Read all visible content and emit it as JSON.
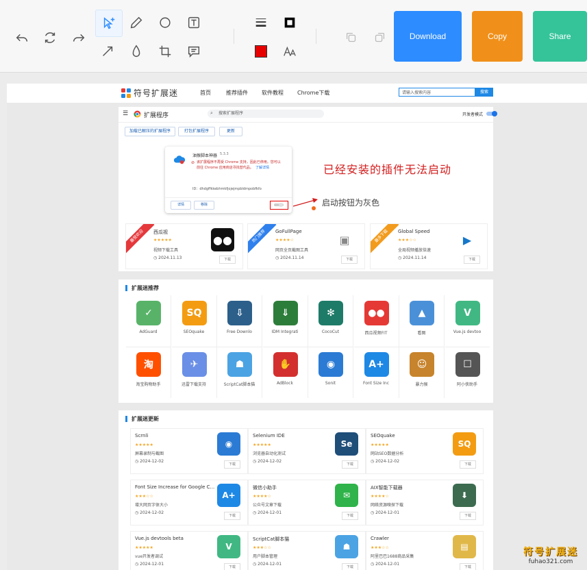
{
  "toolbar": {
    "buttons": {
      "download": "Download",
      "copy": "Copy",
      "share": "Share"
    },
    "colors": {
      "download": "#2d8cff",
      "copy": "#f0901a",
      "share": "#35c49a",
      "swatch": "#e60000"
    }
  },
  "site": {
    "logo_text": "符号扩展迷",
    "nav": [
      "首页",
      "推荐插件",
      "软件教程",
      "Chrome下载"
    ],
    "search_placeholder": "请输入搜索内容",
    "search_button": "搜索"
  },
  "ext_page": {
    "title": "扩展程序",
    "search": "搜索扩展程序",
    "dev_mode": "开发者模式",
    "buttons": [
      "加载已解压的扩展程序",
      "打包扩展程序",
      "更新"
    ],
    "card": {
      "name": "油猴脚本神器",
      "version": "5.3.3",
      "warning": "该扩展程序不再受 Chrome 支持，因此已停用。您可以",
      "warning2": "前往 Chrome 应用商店寻找替代品。",
      "link": "了解详情",
      "id_line": "ID：dhdgffkkebhmkfjojejmpbldmpobfkfo",
      "details": "详情",
      "remove": "移除"
    },
    "annotation_main": "已经安装的插件无法启动",
    "annotation_toggle": "启动按钮为灰色"
  },
  "featured": [
    {
      "ribbon": "最受欢迎",
      "ribbon_color": "#e5383b",
      "name": "西瓜视",
      "stars": "★★★★★",
      "desc": "视频下载工具",
      "date": "2024.11.13",
      "dl": "下载"
    },
    {
      "ribbon": "热门推荐",
      "ribbon_color": "#2f80ed",
      "name": "GoFullPage",
      "stars": "★★★★☆",
      "desc": "网页全页截图工具",
      "date": "2024.11.14",
      "dl": "下载"
    },
    {
      "ribbon": "最多下载",
      "ribbon_color": "#f29b1d",
      "name": "Global Speed",
      "stars": "★★★☆☆",
      "desc": "全局视频播放倍速",
      "date": "2024.11.14",
      "dl": "下载"
    }
  ],
  "recommend": {
    "title": "扩展迷推荐",
    "items": [
      {
        "label": "AdGuard",
        "color": "#58b368",
        "glyph": "✓"
      },
      {
        "label": "SEOquake",
        "color": "#f39c12",
        "glyph": "SQ"
      },
      {
        "label": "Free Downlo",
        "color": "#2c5f8a",
        "glyph": "⇩"
      },
      {
        "label": "IDM Integrati",
        "color": "#2d7d3a",
        "glyph": "⇓"
      },
      {
        "label": "CocoCut",
        "color": "#1e7b67",
        "glyph": "✻"
      },
      {
        "label": "西瓜视频FIT",
        "color": "#e53935",
        "glyph": "●●"
      },
      {
        "label": "看图",
        "color": "#4a90d9",
        "glyph": "▲"
      },
      {
        "label": "Vue.js devtoo",
        "color": "#41b883",
        "glyph": "V"
      },
      {
        "label": "淘宝购物助手",
        "color": "#ff5000",
        "glyph": "淘"
      },
      {
        "label": "迅雷下载支持",
        "color": "#6a8fe6",
        "glyph": "✈"
      },
      {
        "label": "ScriptCat脚本猫",
        "color": "#4ba3e3",
        "glyph": "☗"
      },
      {
        "label": "AdBlock",
        "color": "#d32f2f",
        "glyph": "✋"
      },
      {
        "label": "Sonit",
        "color": "#2b7bd4",
        "glyph": "◉"
      },
      {
        "label": "Font Size Inc",
        "color": "#1e88e5",
        "glyph": "A+"
      },
      {
        "label": "暴力猴",
        "color": "#c7842c",
        "glyph": "☺"
      },
      {
        "label": "阿小侠助手",
        "color": "#555555",
        "glyph": "☐"
      }
    ]
  },
  "updates": {
    "title": "扩展迷更新",
    "items": [
      {
        "name": "Scrnli",
        "stars": "★★★★★",
        "desc": "屏幕录制与截图",
        "date": "2024-12-02",
        "color": "#2b7bd4",
        "glyph": "◉",
        "dl": "下载"
      },
      {
        "name": "Selenium IDE",
        "stars": "★★★★★",
        "desc": "浏览器自动化测试",
        "date": "2024-12-02",
        "color": "#1f4e79",
        "glyph": "Se",
        "dl": "下载"
      },
      {
        "name": "SEOquake",
        "stars": "★★★★★",
        "desc": "网站SEO数据分析",
        "date": "2024-12-02",
        "color": "#f39c12",
        "glyph": "SQ",
        "dl": "下载"
      },
      {
        "name": "Font Size Increase for Google C...",
        "stars": "★★★☆☆",
        "desc": "增大网页字体大小",
        "date": "2024-12-02",
        "color": "#1e88e5",
        "glyph": "A+",
        "dl": "下载"
      },
      {
        "name": "微信小助手",
        "stars": "★★★★☆",
        "desc": "公众号文章下载",
        "date": "2024-12-01",
        "color": "#2fb34a",
        "glyph": "✉",
        "dl": "下载"
      },
      {
        "name": "AIX智能下载器",
        "stars": "★★★★☆",
        "desc": "网络资源嗅探下载",
        "date": "2024-12-01",
        "color": "#3d6b4f",
        "glyph": "⬇",
        "dl": "下载"
      },
      {
        "name": "Vue.js devtools beta",
        "stars": "★★★★★",
        "desc": "vue开发者调试",
        "date": "2024-12-01",
        "color": "#41b883",
        "glyph": "V",
        "dl": "下载"
      },
      {
        "name": "ScriptCat脚本猫",
        "stars": "★★★☆☆",
        "desc": "用户脚本管理",
        "date": "2024-12-01",
        "color": "#4ba3e3",
        "glyph": "☗",
        "dl": "下载"
      },
      {
        "name": "Crawler",
        "stars": "★★★☆☆",
        "desc": "阿里巴巴1688商品采集",
        "date": "2024-12-01",
        "color": "#e0b84a",
        "glyph": "▤",
        "dl": "下载"
      }
    ]
  },
  "watermark": {
    "title": "符号扩展迷",
    "url": "fuhao321.com"
  }
}
